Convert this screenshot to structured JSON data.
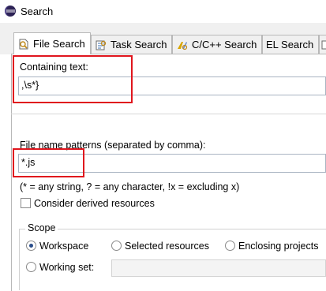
{
  "window": {
    "title": "Search",
    "icon": "eclipse-icon"
  },
  "tabs": [
    {
      "label": "File Search",
      "icon": "file-search-icon",
      "active": true
    },
    {
      "label": "Task Search",
      "icon": "task-search-icon",
      "active": false
    },
    {
      "label": "C/C++ Search",
      "icon": "cpp-search-icon",
      "active": false
    },
    {
      "label": "EL Search",
      "icon": "el-search-icon",
      "active": false
    }
  ],
  "containing_text": {
    "label": "Containing text:",
    "value": ",\\s*}"
  },
  "file_patterns": {
    "label": "File name patterns (separated by comma):",
    "value": "*.js",
    "hint": "(* = any string, ? = any character, !x = excluding x)"
  },
  "options": {
    "derived_label": "Consider derived resources",
    "derived_checked": false
  },
  "scope": {
    "title": "Scope",
    "options": [
      {
        "label": "Workspace",
        "selected": true
      },
      {
        "label": "Selected resources",
        "selected": false
      },
      {
        "label": "Enclosing projects",
        "selected": false
      },
      {
        "label": "Working set:",
        "selected": false
      }
    ],
    "working_set_value": ""
  },
  "colors": {
    "highlight_box": "#e0151d",
    "tab_border": "#b8b8b8",
    "radio_dot": "#2a4d8a"
  }
}
